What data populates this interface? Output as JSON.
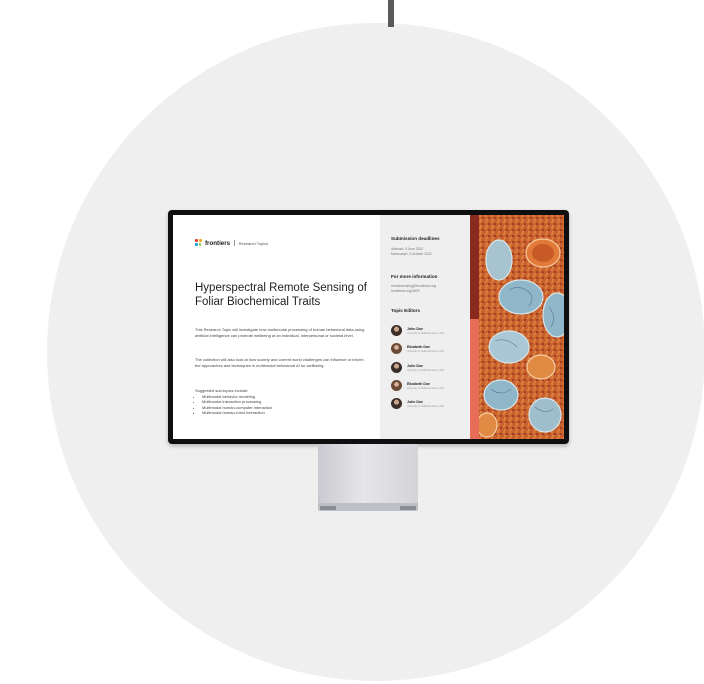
{
  "brand": {
    "logo_text": "frontiers",
    "sub": "Research Topics",
    "logo_colors": [
      "#e4412b",
      "#f5a623",
      "#1aa0d8",
      "#8bc34a"
    ]
  },
  "title": "Hyperspectral Remote Sensing of Foliar Biochemical Traits",
  "paragraphs": [
    "This Research Topic will investigate how multimodal processing of human behavioral data using artificial intelligence can promote wellbeing at an individual, interpersonal or societal level.",
    "The collection will also look at how society and current world challenges can influence or inform the approaches and techniques in multimodal behavioral AI for wellbeing."
  ],
  "subtopics": {
    "heading": "Suggested sub-topics include:",
    "items": [
      "Multimodal behavior modeling",
      "Multimodal interaction processing",
      "Multimodal human-computer interaction",
      "Multimodal human-robot interaction"
    ]
  },
  "deadlines": {
    "heading": "Submission deadlines",
    "abstract": "Abstract: 3 June 2022",
    "manuscript": "Manuscript: 3 October 2022"
  },
  "info": {
    "heading": "For more information",
    "email": "remotesensing@frontiersin.org",
    "link": "frontiersin.org/3829"
  },
  "editors": {
    "heading": "Topic Editors",
    "list": [
      {
        "name": "John Doe",
        "affiliation": "University of California Davis, USA"
      },
      {
        "name": "Elizabeth Doe",
        "affiliation": "University of California Davis, USA"
      },
      {
        "name": "John Doe",
        "affiliation": "University of California Davis, USA"
      },
      {
        "name": "Elizabeth Doe",
        "affiliation": "University of California Davis, USA"
      },
      {
        "name": "John Doe",
        "affiliation": "University of California Davis, USA"
      }
    ]
  },
  "colors": {
    "accent": "#e76d59",
    "page_background": "#efefef",
    "bezel": "#0f0f0f"
  }
}
